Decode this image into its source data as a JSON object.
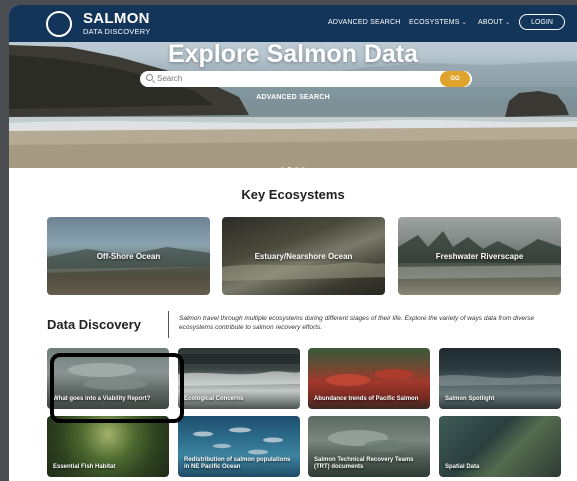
{
  "brand": {
    "name": "SALMON",
    "subtitle": "DATA DISCOVERY"
  },
  "nav": {
    "advanced_search": "ADVANCED SEARCH",
    "ecosystems": "ECOSYSTEMS",
    "about": "ABOUT",
    "login": "LOGIN",
    "chevron": "⌄"
  },
  "hero": {
    "title": "Explore Salmon Data",
    "search_placeholder": "Search",
    "go_label": "GO",
    "advanced_link": "ADVANCED SEARCH"
  },
  "key_ecosystems": {
    "title": "Key Ecosystems",
    "items": [
      {
        "label": "Off-Shore Ocean"
      },
      {
        "label": "Estuary/Nearshore Ocean"
      },
      {
        "label": "Freshwater Riverscape"
      }
    ]
  },
  "data_discovery": {
    "title": "Data Discovery",
    "description": "Salmon travel through multiple ecosystems during different stages of their life. Explore the variety of ways data from diverse ecosystems contribute to salmon recovery efforts.",
    "cards": [
      {
        "label": "What goes into a Viability Report?"
      },
      {
        "label": "Ecological Concerns"
      },
      {
        "label": "Abundance trends of Pacific Salmon"
      },
      {
        "label": "Salmon Spotlight"
      },
      {
        "label": "Essential Fish Habitat"
      },
      {
        "label": "Redistribution of salmon populations in NE Pacific Ocean"
      },
      {
        "label": "Salmon Technical Recovery Teams (TRT) documents"
      },
      {
        "label": "Spatial Data"
      }
    ]
  },
  "colors": {
    "nav_bg": "#14355a",
    "go_button": "#e0a32e",
    "highlight": "#000000"
  }
}
